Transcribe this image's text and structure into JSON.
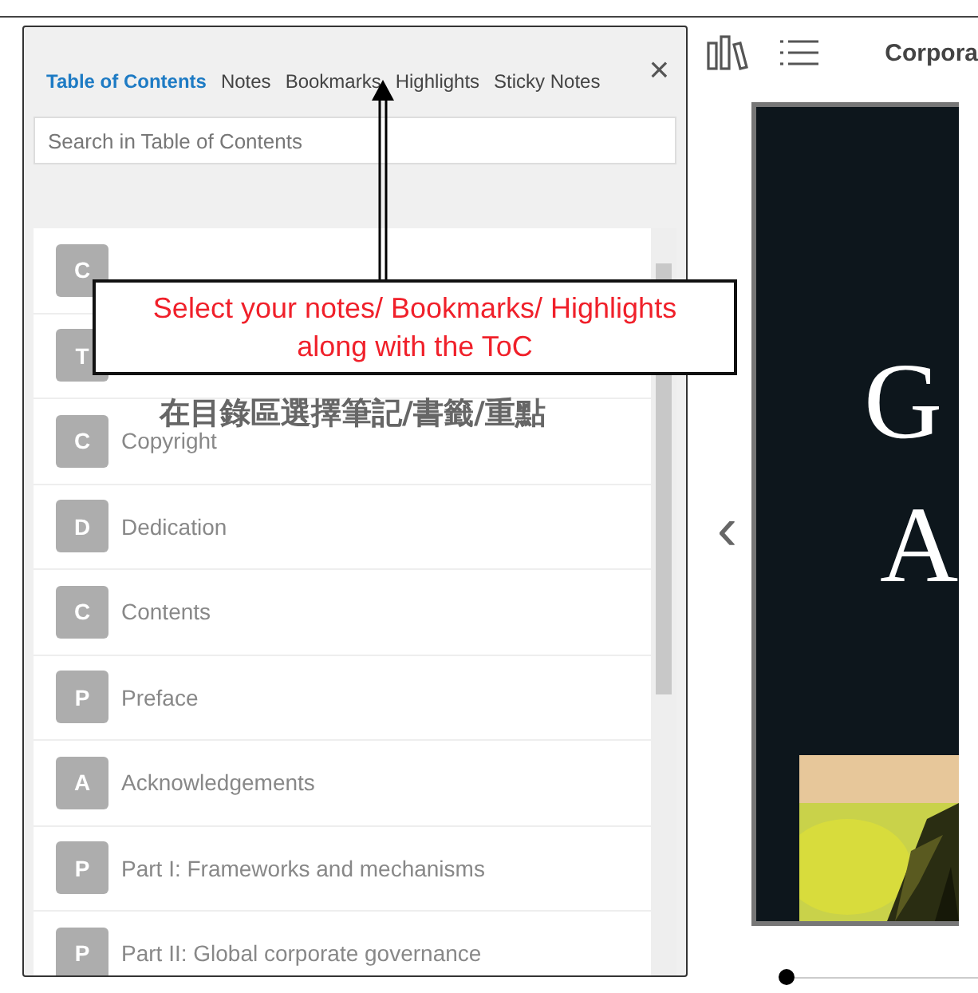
{
  "panel": {
    "tabs": [
      {
        "label": "Table of Contents",
        "selected": true
      },
      {
        "label": "Notes",
        "selected": false
      },
      {
        "label": "Bookmarks",
        "selected": false
      },
      {
        "label": "Highlights",
        "selected": false
      },
      {
        "label": "Sticky Notes",
        "selected": false
      }
    ],
    "close": "×",
    "search": {
      "placeholder": "Search in Table of Contents"
    },
    "toc": [
      {
        "letter": "C"
      },
      {
        "letter": "T"
      },
      {
        "letter": "C",
        "title": "Copyright"
      },
      {
        "letter": "D",
        "title": "Dedication"
      },
      {
        "letter": "C",
        "title": "Contents"
      },
      {
        "letter": "P",
        "title": "Preface"
      },
      {
        "letter": "A",
        "title": "Acknowledgements"
      },
      {
        "letter": "P",
        "title": "Part I: Frameworks and mechanisms"
      },
      {
        "letter": "P",
        "title": "Part II: Global corporate governance"
      }
    ]
  },
  "reader": {
    "title": "Corpora",
    "progress": {
      "level": 0
    },
    "prev": "‹",
    "cover": {
      "line_1": "G",
      "line_2": "A"
    }
  },
  "callout": {
    "text": "Select your notes/ Bookmarks/ Highlights along with the ToC",
    "caption": "在目錄區選擇筆記/書籤/重點"
  }
}
